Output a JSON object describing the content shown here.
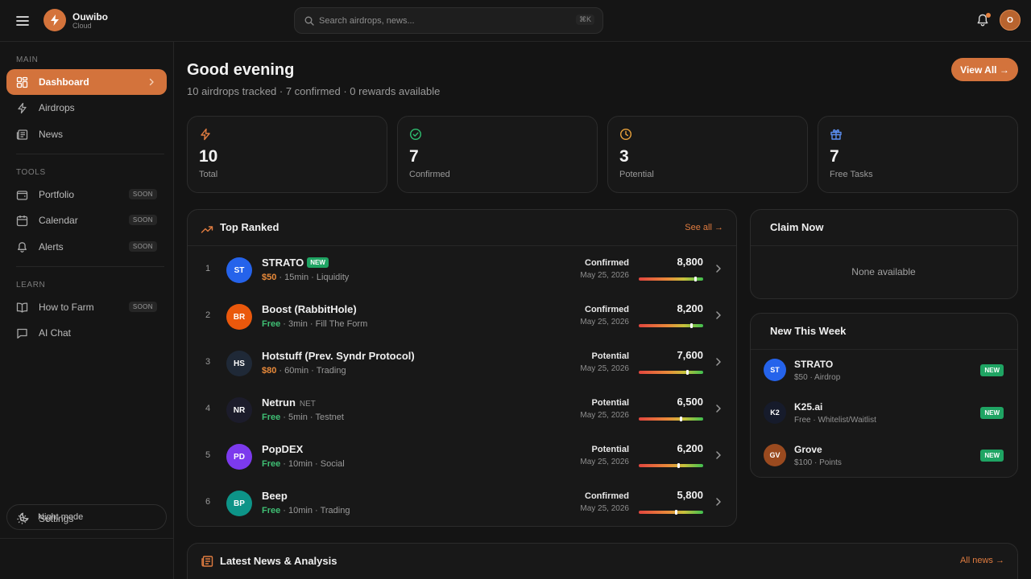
{
  "brand": {
    "name": "Ouwibo",
    "sub": "Cloud"
  },
  "search": {
    "placeholder": "Search airdrops, news...",
    "shortcut": "⌘K"
  },
  "user": {
    "initial": "O"
  },
  "icons": {
    "menu": "menu-icon",
    "logo": "lightning-icon",
    "search": "search-icon",
    "notifications": "bell-icon",
    "dashboard": "grid-icon",
    "airdrops": "lightning-icon",
    "news": "newspaper-icon",
    "portfolio": "wallet-icon",
    "calendar": "calendar-icon",
    "alerts": "bell-icon",
    "how_to_farm": "book-icon",
    "ai_chat": "message-icon",
    "settings": "gear-icon",
    "night_mode": "moon-icon"
  },
  "colors": {
    "accent": "#d3733c",
    "new_badge": "#1fa463",
    "free": "#3fbf74",
    "paid": "#e98a3a"
  },
  "sidebar": {
    "sections": {
      "main": "MAIN",
      "tools": "TOOLS",
      "learn": "LEARN"
    },
    "items": [
      {
        "label": "Dashboard"
      },
      {
        "label": "Airdrops"
      },
      {
        "label": "News"
      },
      {
        "label": "Portfolio",
        "badge": "SOON"
      },
      {
        "label": "Calendar",
        "badge": "SOON"
      },
      {
        "label": "Alerts",
        "badge": "SOON"
      },
      {
        "label": "How to Farm",
        "badge": "SOON"
      },
      {
        "label": "AI Chat"
      }
    ],
    "settings": "Settings",
    "night_mode": "Night mode"
  },
  "header": {
    "greeting": "Good evening",
    "subline": "10 airdrops tracked · 7 confirmed · 0 rewards available",
    "view_all": "View All →"
  },
  "stats": [
    {
      "value": "10",
      "label": "Total"
    },
    {
      "value": "7",
      "label": "Confirmed"
    },
    {
      "value": "3",
      "label": "Potential"
    },
    {
      "value": "7",
      "label": "Free Tasks"
    }
  ],
  "top_ranked": {
    "title": "Top Ranked",
    "link": "See all →",
    "rows": [
      {
        "rank": "1",
        "initials": "ST",
        "name": "STRATO",
        "tag": "NEW",
        "ticker": "",
        "price": "$50",
        "paid": true,
        "time": "15min",
        "category": "Liquidity",
        "status": "Confirmed",
        "date": "May 25, 2026",
        "score": "8,800",
        "score_value": 8800,
        "avatar_color": "#2563eb"
      },
      {
        "rank": "2",
        "initials": "BR",
        "name": "Boost (RabbitHole)",
        "tag": "",
        "ticker": "",
        "price": "Free",
        "paid": false,
        "time": "3min",
        "category": "Fill The Form",
        "status": "Confirmed",
        "date": "May 25, 2026",
        "score": "8,200",
        "score_value": 8200,
        "avatar_color": "#ea580c"
      },
      {
        "rank": "3",
        "initials": "HS",
        "name": "Hotstuff (Prev. Syndr Protocol)",
        "tag": "",
        "ticker": "",
        "price": "$80",
        "paid": true,
        "time": "60min",
        "category": "Trading",
        "status": "Potential",
        "date": "May 25, 2026",
        "score": "7,600",
        "score_value": 7600,
        "avatar_color": "#1f2937"
      },
      {
        "rank": "4",
        "initials": "NR",
        "name": "Netrun",
        "tag": "",
        "ticker": "NET",
        "price": "Free",
        "paid": false,
        "time": "5min",
        "category": "Testnet",
        "status": "Potential",
        "date": "May 25, 2026",
        "score": "6,500",
        "score_value": 6500,
        "avatar_color": "#1c1c2b"
      },
      {
        "rank": "5",
        "initials": "PD",
        "name": "PopDEX",
        "tag": "",
        "ticker": "",
        "price": "Free",
        "paid": false,
        "time": "10min",
        "category": "Social",
        "status": "Potential",
        "date": "May 25, 2026",
        "score": "6,200",
        "score_value": 6200,
        "avatar_color": "#7c3aed"
      },
      {
        "rank": "6",
        "initials": "BP",
        "name": "Beep",
        "tag": "",
        "ticker": "",
        "price": "Free",
        "paid": false,
        "time": "10min",
        "category": "Trading",
        "status": "Confirmed",
        "date": "May 25, 2026",
        "score": "5,800",
        "score_value": 5800,
        "avatar_color": "#0d9488"
      }
    ]
  },
  "claim_now": {
    "title": "Claim Now",
    "empty": "None available"
  },
  "new_this_week": {
    "title": "New This Week",
    "items": [
      {
        "initials": "ST",
        "name": "STRATO",
        "meta": "$50 · Airdrop",
        "badge": "NEW",
        "avatar_color": "#2563eb"
      },
      {
        "initials": "K2",
        "name": "K25.ai",
        "meta": "Free · Whitelist/Waitlist",
        "badge": "NEW",
        "avatar_color": "#161b2b"
      },
      {
        "initials": "GV",
        "name": "Grove",
        "meta": "$100 · Points",
        "badge": "NEW",
        "avatar_color": "#9a4a1f"
      }
    ]
  },
  "latest_news": {
    "title": "Latest News & Analysis",
    "link": "All news →"
  }
}
